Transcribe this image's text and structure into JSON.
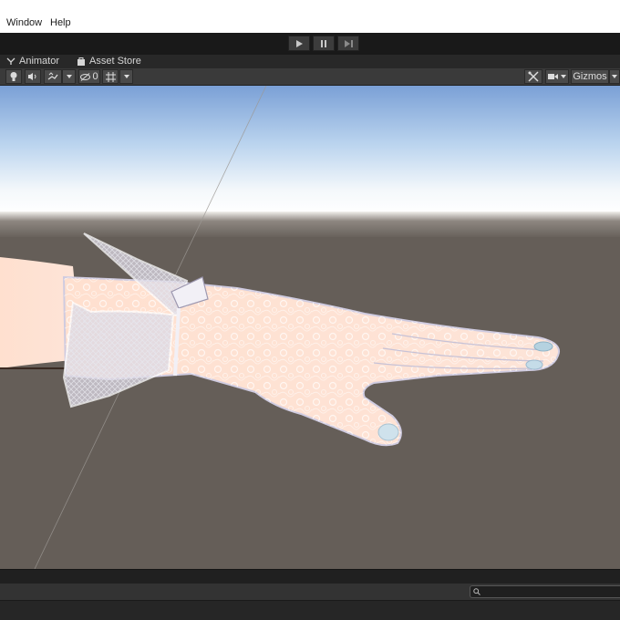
{
  "menu": {
    "window_label": "Window",
    "help_label": "Help"
  },
  "playbar": {
    "play_icon": "play-icon",
    "pause_icon": "pause-icon",
    "step_icon": "step-forward-icon"
  },
  "tabs": [
    {
      "label": "Animator",
      "icon": "animator-icon"
    },
    {
      "label": "Asset Store",
      "icon": "asset-store-icon"
    }
  ],
  "scene_toolbar": {
    "hidden_count": "0",
    "gizmos_label": "Gizmos"
  },
  "search": {
    "icon": "search-icon",
    "placeholder": ""
  },
  "colors": {
    "sky_top": "#7aa0d6",
    "horizon": "#ffffff",
    "ground": "#655e58",
    "toolbar": "#3a3a3a"
  }
}
